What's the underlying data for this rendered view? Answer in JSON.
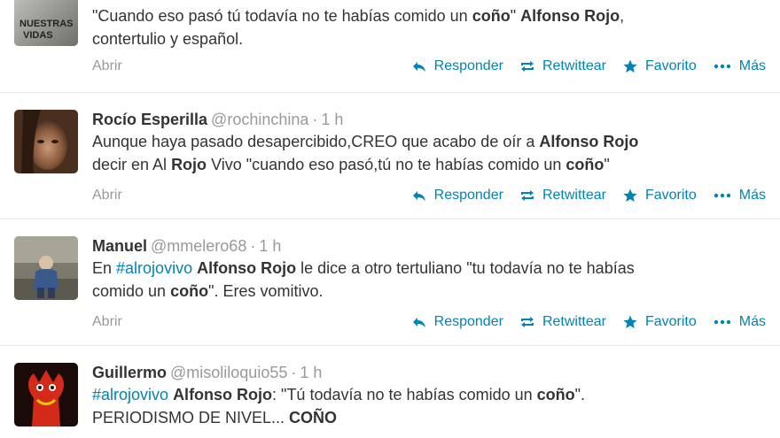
{
  "tweets": [
    {
      "id": "t0",
      "text_segments": [
        {
          "t": "\"Cuando eso pasó tú todavía no te habías comido un ",
          "b": false
        },
        {
          "t": "coño",
          "b": true
        },
        {
          "t": "\" ",
          "b": false
        },
        {
          "t": "Alfonso Rojo",
          "b": true
        },
        {
          "t": ",",
          "b": false
        },
        {
          "t": "\n",
          "b": false
        },
        {
          "t": "contertulio y español.",
          "b": false
        }
      ],
      "avatar_texts": [
        "NUESTRAS",
        "VIDAS"
      ],
      "expand": "Abrir",
      "actions": {
        "reply": "Responder",
        "retweet": "Retwittear",
        "favorite": "Favorito",
        "more": "Más"
      }
    },
    {
      "id": "t1",
      "fullname": "Rocío Esperilla",
      "username": "@rochinchina",
      "time": "1 h",
      "text_segments": [
        {
          "t": "Aunque haya pasado desapercibido,CREO que acabo de oír a ",
          "b": false
        },
        {
          "t": "Alfonso Rojo",
          "b": true
        },
        {
          "t": "\n",
          "b": false
        },
        {
          "t": "decir en Al ",
          "b": false
        },
        {
          "t": "Rojo",
          "b": true
        },
        {
          "t": " Vivo \"cuando eso pasó,tú no te habías comido un ",
          "b": false
        },
        {
          "t": "coño",
          "b": true
        },
        {
          "t": "\"",
          "b": false
        }
      ],
      "expand": "Abrir",
      "actions": {
        "reply": "Responder",
        "retweet": "Retwittear",
        "favorite": "Favorito",
        "more": "Más"
      }
    },
    {
      "id": "t2",
      "fullname": "Manuel",
      "username": "@mmelero68",
      "time": "1 h",
      "text_segments": [
        {
          "t": "En ",
          "b": false
        },
        {
          "t": "#alrojovivo",
          "b": false,
          "tag": true
        },
        {
          "t": " ",
          "b": false
        },
        {
          "t": "Alfonso Rojo",
          "b": true
        },
        {
          "t": " le dice a otro tertuliano \"tu todavía no te habías",
          "b": false
        },
        {
          "t": "\n",
          "b": false
        },
        {
          "t": "comido un ",
          "b": false
        },
        {
          "t": "coño",
          "b": true
        },
        {
          "t": "\". Eres vomitivo.",
          "b": false
        }
      ],
      "expand": "Abrir",
      "actions": {
        "reply": "Responder",
        "retweet": "Retwittear",
        "favorite": "Favorito",
        "more": "Más"
      }
    },
    {
      "id": "t3",
      "fullname": "Guillermo",
      "username": "@misoliloquio55",
      "time": "1 h",
      "text_segments": [
        {
          "t": "#alrojovivo",
          "b": false,
          "tag": true
        },
        {
          "t": " ",
          "b": false
        },
        {
          "t": "Alfonso Rojo",
          "b": true
        },
        {
          "t": ": \"Tú todavía no te habías comido un ",
          "b": false
        },
        {
          "t": "coño",
          "b": true
        },
        {
          "t": "\".",
          "b": false
        },
        {
          "t": "\n",
          "b": false
        },
        {
          "t": "PERIODISMO DE NIVEL... ",
          "b": false
        },
        {
          "t": "COÑO",
          "b": true
        }
      ]
    }
  ],
  "colors": {
    "link": "#0084b4",
    "meta": "#999999",
    "text": "#333333",
    "divider": "#e8e8e8"
  }
}
